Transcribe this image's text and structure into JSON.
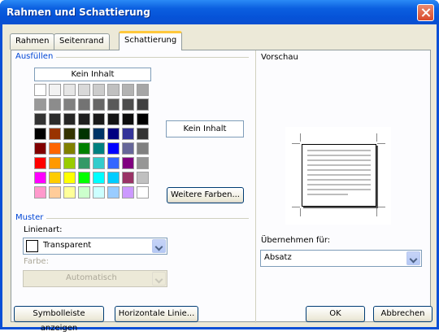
{
  "window": {
    "title": "Rahmen und Schattierung"
  },
  "tabs": [
    "Rahmen",
    "Seitenrand",
    "Schattierung"
  ],
  "fill": {
    "group_label": "Ausfüllen",
    "no_fill_label": "Kein Inhalt",
    "selected_label": "Kein Inhalt",
    "more_colors_label": "Weitere Farben...",
    "palette": [
      [
        "#ffffff",
        "#f2f2f2",
        "#e6e6e6",
        "#d9d9d9",
        "#cccccc",
        "#c0c0c0",
        "#b3b3b3",
        "#a6a6a6"
      ],
      [
        "#999999",
        "#8c8c8c",
        "#808080",
        "#737373",
        "#666666",
        "#595959",
        "#4d4d4d",
        "#404040"
      ],
      [
        "#333333",
        "#2b2b2b",
        "#262626",
        "#1f1f1f",
        "#1a1a1a",
        "#141414",
        "#0d0d0d",
        "#000000"
      ],
      [
        "#000000",
        "#993300",
        "#333300",
        "#003300",
        "#003366",
        "#000080",
        "#333399",
        "#333333"
      ],
      [
        "#800000",
        "#ff6600",
        "#808000",
        "#008000",
        "#008080",
        "#0000ff",
        "#666699",
        "#808080"
      ],
      [
        "#ff0000",
        "#ff9900",
        "#99cc00",
        "#339966",
        "#33cccc",
        "#3366ff",
        "#800080",
        "#969696"
      ],
      [
        "#ff00ff",
        "#ffcc00",
        "#ffff00",
        "#00ff00",
        "#00ffff",
        "#00ccff",
        "#993366",
        "#c0c0c0"
      ],
      [
        "#ff99cc",
        "#ffcc99",
        "#ffff99",
        "#ccffcc",
        "#ccffff",
        "#99ccff",
        "#cc99ff",
        "#ffffff"
      ]
    ]
  },
  "pattern": {
    "group_label": "Muster",
    "style_label": "Linienart:",
    "style_value": "Transparent",
    "color_label": "Farbe:",
    "color_value": "Automatisch"
  },
  "preview": {
    "label": "Vorschau",
    "apply_label": "Übernehmen für:",
    "apply_value": "Absatz"
  },
  "footer": {
    "toolbar_button": "Symbolleiste anzeigen",
    "hline_button": "Horizontale Linie...",
    "ok_button": "OK",
    "cancel_button": "Abbrechen"
  }
}
